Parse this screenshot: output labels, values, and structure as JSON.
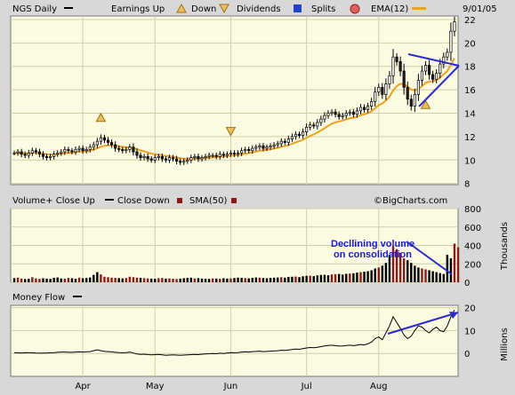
{
  "header": {
    "symbol": "NGS Daily",
    "earnings_label": "Earnings Up",
    "down_label": "Down",
    "dividends_label": "Dividends",
    "splits_label": "Splits",
    "ema_label": "EMA(12)",
    "date": "9/01/05"
  },
  "volume_header": {
    "label": "Volume+ Close Up",
    "close_down_label": "Close Down",
    "sma_label": "SMA(50)",
    "watermark": "©BigCharts.com"
  },
  "moneyflow_header": {
    "label": "Money Flow"
  },
  "annotation": {
    "line1": "Decllining volume",
    "line2": "on consolidation"
  },
  "colors": {
    "price_bg": "#fbfbe2",
    "grid": "#d0d0a8",
    "ema": "#f0a020",
    "up_candle": "#ffffff",
    "down_candle": "#202020",
    "vol_up": "#000000",
    "vol_down": "#8b1a1a",
    "trendline": "#2a2acc",
    "earnings_marker": "#c89020"
  },
  "chart_data": [
    {
      "type": "candlestick",
      "title": "NGS Daily",
      "yticks": [
        8,
        10,
        12,
        14,
        16,
        18,
        20,
        22
      ],
      "ylim": [
        7.9,
        22.3
      ],
      "xticks": [
        "Apr",
        "May",
        "Jun",
        "Jul",
        "Aug"
      ],
      "ema_period": 12,
      "closes": [
        10.6,
        10.7,
        10.5,
        10.4,
        10.6,
        10.8,
        10.7,
        10.5,
        10.3,
        10.2,
        10.3,
        10.5,
        10.6,
        10.7,
        10.9,
        10.8,
        10.7,
        10.9,
        11.0,
        10.8,
        10.9,
        11.1,
        11.3,
        11.6,
        11.9,
        11.7,
        11.5,
        11.3,
        11.0,
        10.9,
        10.8,
        10.9,
        11.1,
        10.7,
        10.4,
        10.2,
        10.3,
        10.1,
        10.0,
        10.2,
        10.3,
        10.1,
        10.0,
        10.2,
        10.1,
        9.9,
        9.8,
        9.9,
        10.0,
        10.2,
        10.3,
        10.1,
        10.2,
        10.3,
        10.4,
        10.4,
        10.3,
        10.5,
        10.4,
        10.5,
        10.6,
        10.5,
        10.6,
        10.8,
        10.9,
        10.8,
        11.0,
        11.1,
        11.2,
        11.0,
        11.1,
        11.2,
        11.3,
        11.4,
        11.6,
        11.5,
        11.8,
        12.0,
        12.2,
        12.1,
        12.4,
        12.8,
        13.0,
        12.9,
        13.2,
        13.5,
        13.8,
        14.0,
        14.1,
        13.9,
        13.7,
        13.8,
        14.0,
        14.1,
        13.9,
        14.2,
        14.5,
        14.3,
        14.6,
        15.0,
        15.8,
        16.2,
        15.6,
        16.5,
        17.2,
        18.8,
        18.4,
        17.6,
        16.2,
        15.2,
        14.6,
        15.6,
        16.8,
        17.6,
        18.1,
        17.3,
        16.9,
        17.4,
        18.2,
        18.8,
        19.2,
        21.0,
        21.8
      ],
      "earnings": [
        {
          "type": "up",
          "date_index": 24,
          "price": 13.6
        },
        {
          "type": "down",
          "date_index": 60,
          "price": 12.4
        },
        {
          "type": "up",
          "date_index": 114,
          "price": 14.7
        }
      ]
    },
    {
      "type": "bar",
      "title": "Volume+ Close Up",
      "ylabel": "Thousands",
      "yticks": [
        0,
        200,
        400,
        600,
        800
      ],
      "ylim": [
        0,
        800
      ],
      "volume": [
        45,
        50,
        40,
        35,
        38,
        55,
        42,
        37,
        44,
        40,
        36,
        48,
        52,
        41,
        39,
        47,
        44,
        38,
        50,
        43,
        46,
        52,
        80,
        110,
        85,
        60,
        55,
        50,
        48,
        45,
        42,
        46,
        60,
        55,
        50,
        48,
        45,
        42,
        40,
        38,
        44,
        46,
        40,
        42,
        38,
        35,
        40,
        44,
        48,
        50,
        42,
        45,
        40,
        38,
        36,
        42,
        40,
        38,
        44,
        40,
        42,
        46,
        50,
        48,
        45,
        42,
        48,
        52,
        50,
        46,
        44,
        48,
        50,
        52,
        55,
        50,
        58,
        60,
        62,
        56,
        65,
        70,
        72,
        66,
        75,
        80,
        82,
        76,
        85,
        88,
        90,
        84,
        92,
        95,
        98,
        105,
        110,
        115,
        120,
        130,
        150,
        160,
        180,
        210,
        300,
        390,
        360,
        320,
        260,
        240,
        210,
        180,
        160,
        150,
        140,
        130,
        120,
        110,
        100,
        90,
        300,
        260,
        420,
        380
      ],
      "up_days": [
        1,
        0,
        0,
        1,
        1,
        0,
        0,
        0,
        1,
        1,
        1,
        1,
        1,
        1,
        0,
        0,
        1,
        1,
        0,
        1,
        1,
        1,
        1,
        1,
        0,
        0,
        0,
        0,
        0,
        1,
        1,
        0,
        0,
        0,
        0,
        1,
        0,
        0,
        1,
        1,
        0,
        0,
        1,
        0,
        0,
        0,
        1,
        1,
        1,
        1,
        0,
        1,
        1,
        1,
        1,
        0,
        1,
        0,
        1,
        1,
        0,
        1,
        1,
        1,
        0,
        1,
        1,
        1,
        0,
        1,
        1,
        1,
        1,
        1,
        0,
        1,
        1,
        1,
        0,
        1,
        1,
        1,
        0,
        1,
        1,
        1,
        1,
        1,
        0,
        0,
        1,
        1,
        1,
        0,
        1,
        1,
        0,
        1,
        1,
        1,
        1,
        0,
        1,
        1,
        1,
        0,
        0,
        0,
        0,
        1,
        1,
        1,
        1,
        0,
        0,
        1,
        1,
        1,
        1,
        1,
        1,
        1
      ]
    },
    {
      "type": "line",
      "title": "Money Flow",
      "ylabel": "Millions",
      "yticks": [
        0,
        10,
        20
      ],
      "ylim": [
        -10,
        21
      ],
      "values": [
        0.3,
        0.3,
        0.2,
        0.4,
        0.3,
        0.3,
        0.2,
        0.1,
        0.2,
        0.2,
        0.3,
        0.4,
        0.5,
        0.6,
        0.6,
        0.5,
        0.5,
        0.6,
        0.7,
        0.6,
        0.7,
        0.8,
        1.2,
        1.6,
        1.2,
        0.9,
        0.8,
        0.7,
        0.5,
        0.4,
        0.3,
        0.4,
        0.6,
        0.2,
        -0.2,
        -0.4,
        -0.3,
        -0.5,
        -0.6,
        -0.5,
        -0.4,
        -0.6,
        -0.8,
        -0.7,
        -0.6,
        -0.7,
        -0.8,
        -0.7,
        -0.6,
        -0.5,
        -0.4,
        -0.5,
        -0.3,
        -0.2,
        -0.1,
        0.0,
        -0.1,
        0.1,
        0.0,
        0.2,
        0.4,
        0.3,
        0.4,
        0.6,
        0.7,
        0.6,
        0.8,
        0.9,
        1.0,
        0.8,
        0.9,
        1.0,
        1.1,
        1.2,
        1.4,
        1.3,
        1.5,
        1.7,
        1.9,
        1.8,
        2.1,
        2.4,
        2.6,
        2.5,
        2.7,
        3.0,
        3.3,
        3.5,
        3.6,
        3.4,
        3.2,
        3.3,
        3.5,
        3.6,
        3.4,
        3.6,
        3.9,
        3.7,
        4.2,
        5.0,
        6.5,
        7.2,
        6.0,
        9.0,
        12.0,
        16.0,
        13.5,
        11.0,
        8.0,
        6.5,
        7.5,
        10.0,
        12.0,
        11.5,
        10.0,
        9.0,
        10.5,
        11.5,
        10.0,
        9.5,
        12.0,
        16.0,
        19.0
      ]
    }
  ]
}
